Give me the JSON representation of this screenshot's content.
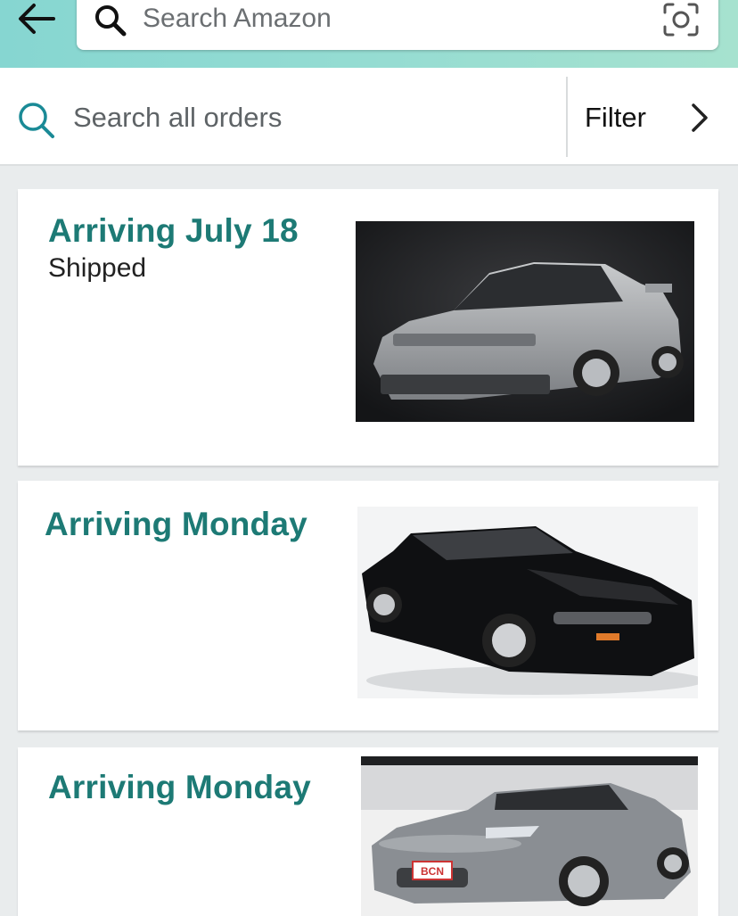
{
  "header": {
    "search_placeholder": "Search Amazon",
    "icons": {
      "back": "back-arrow-icon",
      "search": "search-icon",
      "camera": "camera-scan-icon",
      "mic": "microphone-icon"
    }
  },
  "orders_search": {
    "placeholder": "Search all orders",
    "filter_label": "Filter",
    "icons": {
      "search": "search-icon",
      "chevron": "chevron-right-icon"
    }
  },
  "orders": [
    {
      "status": "Arriving July 18",
      "substatus": "Shipped",
      "image_alt": "Silver sports coupe with pop-up headlights"
    },
    {
      "status": "Arriving Monday",
      "substatus": "",
      "image_alt": "Black sports coupe on white background"
    },
    {
      "status": "Arriving Monday",
      "substatus": "",
      "image_alt": "Grey sports coupe in showroom"
    }
  ],
  "colors": {
    "header_teal": "#8fd9d2",
    "status_green": "#1d7a75"
  }
}
